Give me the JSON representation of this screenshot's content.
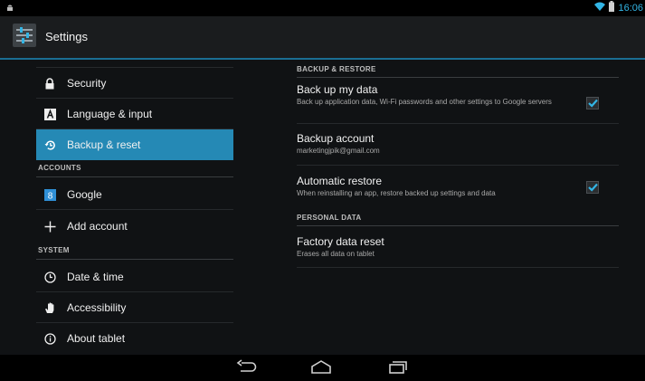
{
  "app": {
    "title": "Settings"
  },
  "statusbar": {
    "time": "16:06",
    "icons": [
      "android-icon",
      "wifi-icon",
      "battery-icon"
    ]
  },
  "sidebar": {
    "items": [
      {
        "label": "Security",
        "icon": "lock-icon"
      },
      {
        "label": "Language & input",
        "icon": "language-icon"
      },
      {
        "label": "Backup & reset",
        "icon": "backup-icon",
        "active": true
      },
      {
        "label": "Google",
        "icon": "google-icon"
      },
      {
        "label": "Add account",
        "icon": "plus-icon"
      },
      {
        "label": "Date & time",
        "icon": "clock-icon"
      },
      {
        "label": "Accessibility",
        "icon": "hand-icon"
      },
      {
        "label": "About tablet",
        "icon": "info-icon"
      }
    ],
    "sections": {
      "accounts": "ACCOUNTS",
      "system": "SYSTEM"
    }
  },
  "main": {
    "sections": {
      "backup_restore": "BACKUP & RESTORE",
      "personal_data": "PERSONAL DATA"
    },
    "items": [
      {
        "title": "Back up my data",
        "subtitle": "Back up application data, Wi-Fi passwords and other settings to Google servers",
        "checked": true
      },
      {
        "title": "Backup account",
        "subtitle": "marketingjpik@gmail.com"
      },
      {
        "title": "Automatic restore",
        "subtitle": "When reinstalling an app, restore backed up settings and data",
        "checked": true
      },
      {
        "title": "Factory data reset",
        "subtitle": "Erases all data on tablet"
      }
    ]
  },
  "colors": {
    "accent": "#33b5e5",
    "active": "#2589b5"
  },
  "navbar": {
    "buttons": [
      "back-icon",
      "home-icon",
      "recents-icon"
    ]
  }
}
